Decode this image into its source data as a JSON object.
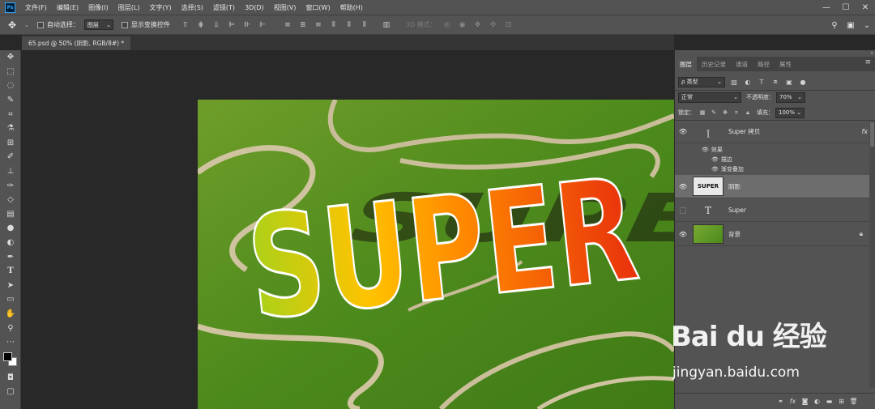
{
  "app": {
    "logo": "Ps"
  },
  "menu": [
    "文件(F)",
    "编辑(E)",
    "图像(I)",
    "图层(L)",
    "文字(Y)",
    "选择(S)",
    "滤镜(T)",
    "3D(D)",
    "视图(V)",
    "窗口(W)",
    "帮助(H)"
  ],
  "window_controls": {
    "minimize": "—",
    "maximize": "☐",
    "close": "✕"
  },
  "options": {
    "auto_select_label": "自动选择：",
    "auto_select_value": "图层",
    "transform_label": "显示变换控件",
    "mode3d_label": "3D 模式："
  },
  "document": {
    "tab_title": "65.psd @ 50% (阴影, RGB/8#) *"
  },
  "panel": {
    "collapse": "»",
    "tabs": [
      "图层",
      "历史记录",
      "通道",
      "路径",
      "属性"
    ],
    "menu_icon": "≡",
    "kind_filter": "ρ 类型",
    "blend_mode": "正常",
    "opacity_label": "不透明度：",
    "opacity_value": "70%",
    "lock_label": "锁定：",
    "fill_label": "填充：",
    "fill_value": "100%"
  },
  "layers": [
    {
      "name": "Super 拷贝",
      "fx": "fx",
      "effects_label": "效果",
      "effects": [
        "描边",
        "渐变叠加"
      ]
    },
    {
      "name": "阴影",
      "thumb_text": "SUPER"
    },
    {
      "name": "Super",
      "type_glyph": "T"
    },
    {
      "name": "背景"
    }
  ],
  "canvas": {
    "art_text": "SUPER"
  },
  "colors": {
    "accent": "#31a8ff",
    "panel_bg": "#535353",
    "selected_layer": "#6d6d6d"
  },
  "watermark": {
    "logo": "Bai du 经验",
    "url": "jingyan.baidu.com"
  }
}
